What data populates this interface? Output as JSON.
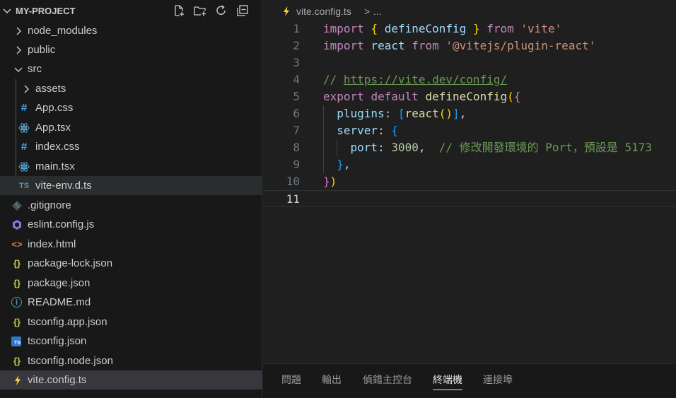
{
  "explorer": {
    "title": "MY-PROJECT",
    "toolbar": [
      "new-file-icon",
      "new-folder-icon",
      "refresh-icon",
      "collapse-all-icon"
    ],
    "items": [
      {
        "label": "node_modules",
        "type": "folder",
        "expanded": false,
        "depth": 0
      },
      {
        "label": "public",
        "type": "folder",
        "expanded": false,
        "depth": 0
      },
      {
        "label": "src",
        "type": "folder",
        "expanded": true,
        "depth": 0
      },
      {
        "label": "assets",
        "type": "folder",
        "expanded": false,
        "depth": 1
      },
      {
        "label": "App.css",
        "type": "css",
        "depth": 1
      },
      {
        "label": "App.tsx",
        "type": "react",
        "depth": 1
      },
      {
        "label": "index.css",
        "type": "css",
        "depth": 1
      },
      {
        "label": "main.tsx",
        "type": "react",
        "depth": 1
      },
      {
        "label": "vite-env.d.ts",
        "type": "ts",
        "depth": 1,
        "badge": "TS"
      },
      {
        "label": ".gitignore",
        "type": "git",
        "depth": 0
      },
      {
        "label": "eslint.config.js",
        "type": "eslint",
        "depth": 0
      },
      {
        "label": "index.html",
        "type": "html",
        "depth": 0,
        "badge": "<>"
      },
      {
        "label": "package-lock.json",
        "type": "json",
        "depth": 0,
        "badge": "{}"
      },
      {
        "label": "package.json",
        "type": "json",
        "depth": 0,
        "badge": "{}"
      },
      {
        "label": "README.md",
        "type": "info",
        "depth": 0,
        "badge": "i"
      },
      {
        "label": "tsconfig.app.json",
        "type": "json",
        "depth": 0,
        "badge": "{}"
      },
      {
        "label": "tsconfig.json",
        "type": "tsjson",
        "depth": 0,
        "badge": "TS"
      },
      {
        "label": "tsconfig.node.json",
        "type": "json",
        "depth": 0,
        "badge": "{}"
      },
      {
        "label": "vite.config.ts",
        "type": "vite",
        "depth": 0,
        "selected": true
      }
    ]
  },
  "breadcrumb": {
    "file": "vite.config.ts",
    "separator": ">",
    "more": "..."
  },
  "editor": {
    "active_line": 11,
    "lines": [
      {
        "n": "1",
        "tokens": [
          [
            "kw",
            "import"
          ],
          [
            "pl",
            " "
          ],
          [
            "b1",
            "{"
          ],
          [
            "pl",
            " "
          ],
          [
            "id",
            "defineConfig"
          ],
          [
            "pl",
            " "
          ],
          [
            "b1",
            "}"
          ],
          [
            "pl",
            " "
          ],
          [
            "kw",
            "from"
          ],
          [
            "pl",
            " "
          ],
          [
            "str",
            "'vite'"
          ]
        ]
      },
      {
        "n": "2",
        "tokens": [
          [
            "kw",
            "import"
          ],
          [
            "pl",
            " "
          ],
          [
            "id",
            "react"
          ],
          [
            "pl",
            " "
          ],
          [
            "kw",
            "from"
          ],
          [
            "pl",
            " "
          ],
          [
            "str",
            "'@vitejs/plugin-react'"
          ]
        ]
      },
      {
        "n": "3",
        "tokens": []
      },
      {
        "n": "4",
        "tokens": [
          [
            "cm",
            "// "
          ],
          [
            "link",
            "https://vite.dev/config/"
          ]
        ]
      },
      {
        "n": "5",
        "tokens": [
          [
            "kw",
            "export"
          ],
          [
            "pl",
            " "
          ],
          [
            "kw",
            "default"
          ],
          [
            "pl",
            " "
          ],
          [
            "fn",
            "defineConfig"
          ],
          [
            "b1",
            "("
          ],
          [
            "b2",
            "{"
          ]
        ]
      },
      {
        "n": "6",
        "tokens": [
          [
            "pl",
            "  "
          ],
          [
            "id",
            "plugins"
          ],
          [
            "pl",
            ": "
          ],
          [
            "b3",
            "["
          ],
          [
            "fn",
            "react"
          ],
          [
            "b1",
            "()"
          ],
          [
            "b3",
            "]"
          ],
          [
            "pl",
            ","
          ]
        ]
      },
      {
        "n": "7",
        "tokens": [
          [
            "pl",
            "  "
          ],
          [
            "id",
            "server"
          ],
          [
            "pl",
            ": "
          ],
          [
            "b3",
            "{"
          ]
        ]
      },
      {
        "n": "8",
        "tokens": [
          [
            "pl",
            "    "
          ],
          [
            "id",
            "port"
          ],
          [
            "pl",
            ": "
          ],
          [
            "num",
            "3000"
          ],
          [
            "pl",
            ",  "
          ],
          [
            "cm",
            "// 修改開發環境的 Port，預設是 5173"
          ]
        ]
      },
      {
        "n": "9",
        "tokens": [
          [
            "pl",
            "  "
          ],
          [
            "b3",
            "}"
          ],
          [
            "pl",
            ","
          ]
        ]
      },
      {
        "n": "10",
        "tokens": [
          [
            "b2",
            "}"
          ],
          [
            "b1",
            ")"
          ]
        ]
      },
      {
        "n": "11",
        "tokens": []
      }
    ]
  },
  "panel": {
    "tabs": [
      {
        "label": "問題",
        "active": false
      },
      {
        "label": "輸出",
        "active": false
      },
      {
        "label": "偵錯主控台",
        "active": false
      },
      {
        "label": "終端機",
        "active": true
      },
      {
        "label": "連接埠",
        "active": false
      }
    ]
  },
  "colors": {
    "background": "#1f1f1f",
    "sidebar": "#181818",
    "selection": "#37373d",
    "keyword": "#c586c0",
    "variable": "#9cdcfe",
    "function": "#dcdcaa",
    "string": "#ce9178",
    "number": "#b5cea8",
    "comment": "#6a9955"
  }
}
